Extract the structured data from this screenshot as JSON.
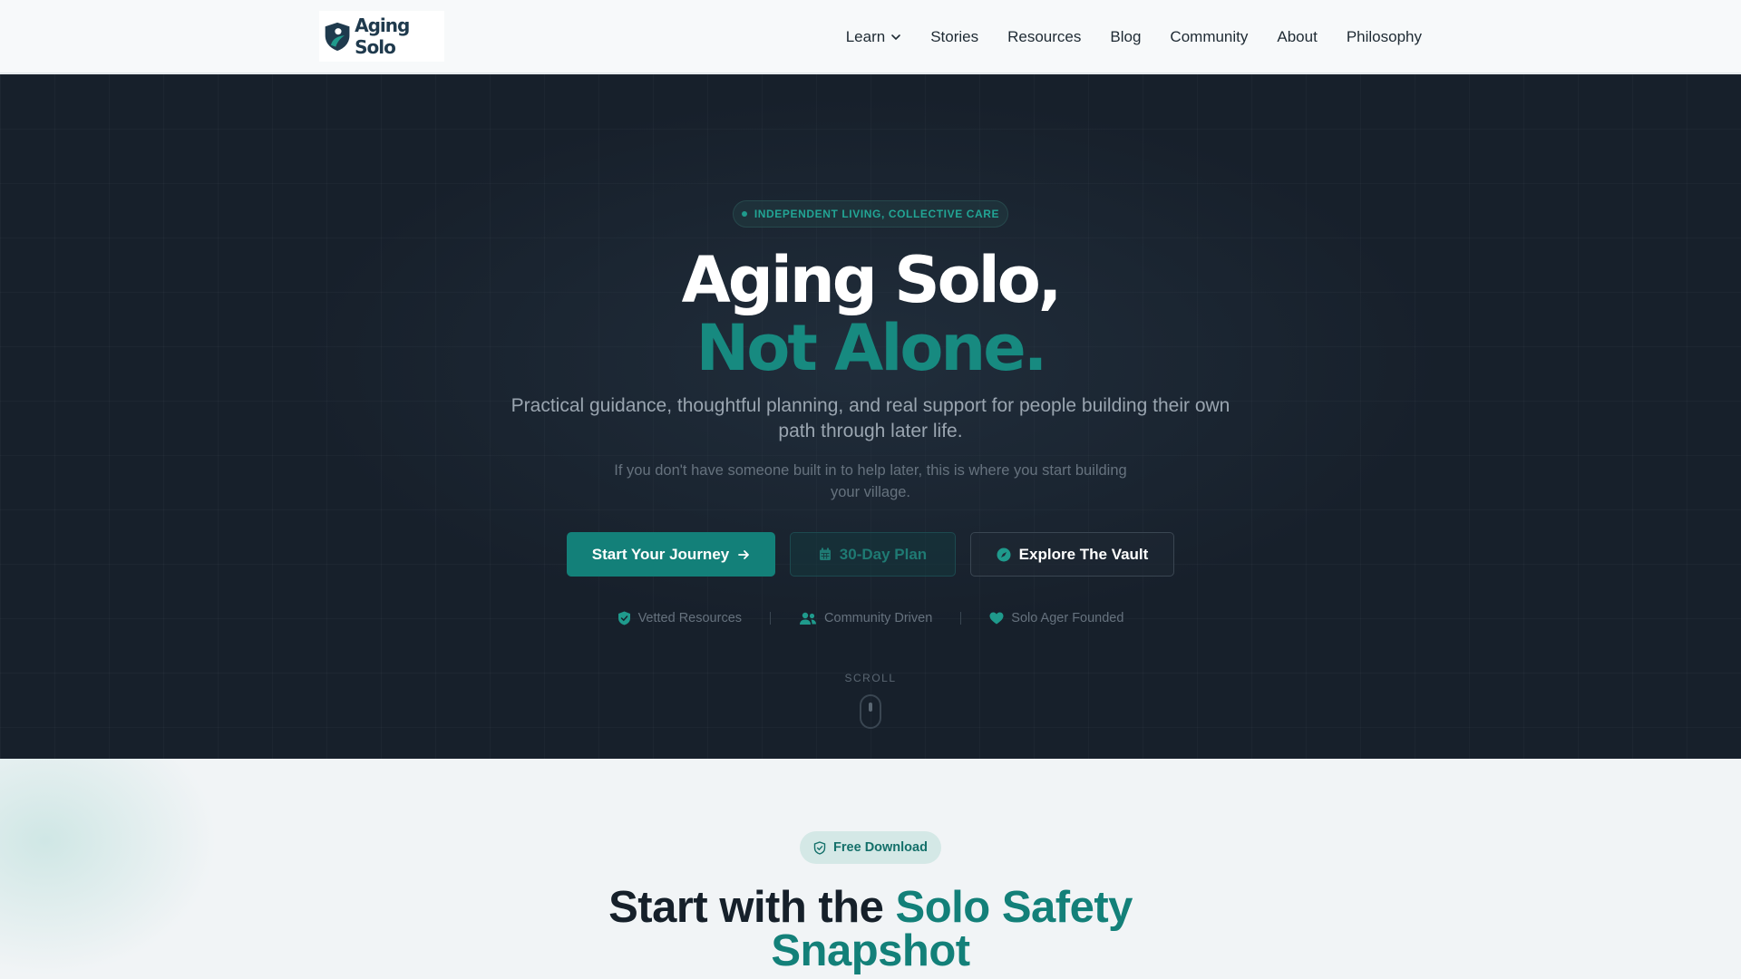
{
  "nav": {
    "logo_text": "Aging Solo",
    "links": [
      {
        "label": "Learn",
        "has_dropdown": true
      },
      {
        "label": "Stories"
      },
      {
        "label": "Resources"
      },
      {
        "label": "Blog"
      },
      {
        "label": "Community"
      },
      {
        "label": "About"
      },
      {
        "label": "Philosophy"
      }
    ]
  },
  "hero": {
    "badge": "INDEPENDENT LIVING, COLLECTIVE CARE",
    "title_line1": "Aging Solo,",
    "title_line2": "Not Alone.",
    "subtitle": "Practical guidance, thoughtful planning, and real support for people building their own path through later life.",
    "subtitle2": "If you don't have someone built in to help later, this is where you start building your village.",
    "buttons": {
      "primary": "Start Your Journey",
      "plan": "30-Day Plan",
      "vault": "Explore The Vault"
    },
    "trust": [
      "Vetted Resources",
      "Community Driven",
      "Solo Ager Founded"
    ],
    "scroll_label": "SCROLL"
  },
  "section2": {
    "pill": "Free Download",
    "title_prefix": "Start with the ",
    "title_accent1": "Solo Safety",
    "title_accent2": "Snapshot"
  },
  "colors": {
    "accent": "#138079",
    "hero_bg": "#17202b",
    "nav_bg": "#f7f9fa"
  },
  "icons": {
    "logo": "shield-person-icon",
    "learn_dropdown": "chevron-down-icon",
    "primary_button": "arrow-right-icon",
    "plan_button": "calendar-icon",
    "vault_button": "compass-icon",
    "trust": [
      "shield-check-icon",
      "users-icon",
      "heart-icon"
    ],
    "pill": "shield-check-icon"
  }
}
